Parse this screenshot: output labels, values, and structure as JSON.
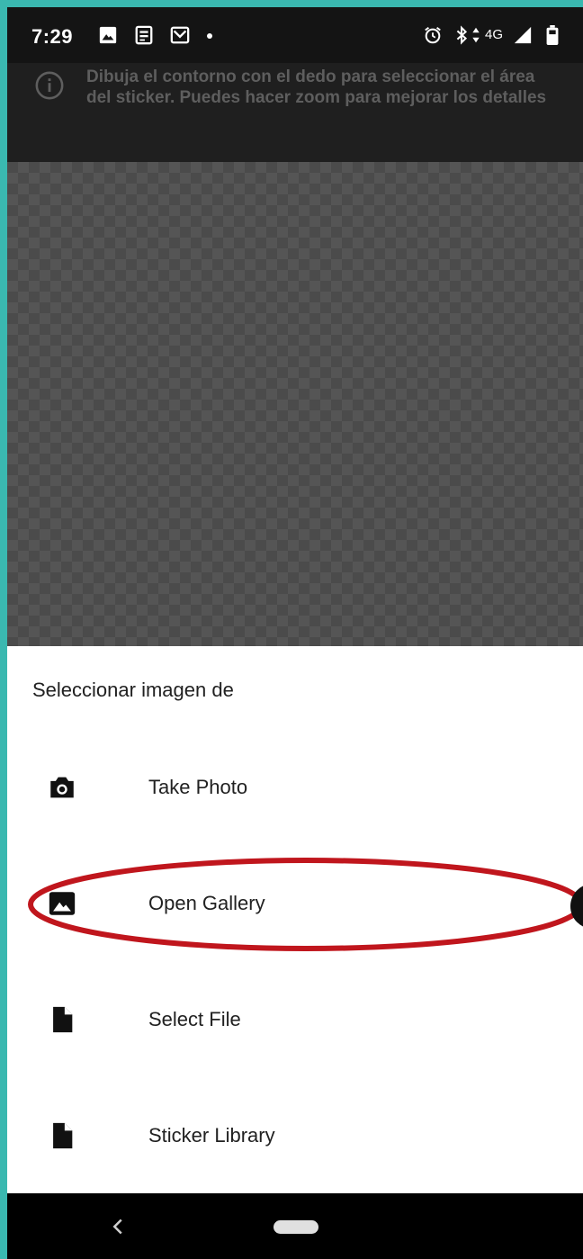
{
  "status_bar": {
    "time": "7:29",
    "network": "4G",
    "icons": [
      "image-notification-icon",
      "news-notification-icon",
      "mail-notification-icon",
      "alarm-icon",
      "bluetooth-icon",
      "data-arrows-icon",
      "signal-icon",
      "battery-icon"
    ]
  },
  "hint": {
    "icon": "info-icon",
    "text": "Dibuja el contorno con el dedo para seleccionar el área del sticker. Puedes hacer zoom para mejorar los detalles"
  },
  "sheet": {
    "title": "Seleccionar imagen de",
    "options": [
      {
        "label": "Take Photo",
        "icon": "camera-icon"
      },
      {
        "label": "Open Gallery",
        "icon": "gallery-icon",
        "highlighted": true
      },
      {
        "label": "Select File",
        "icon": "file-icon"
      },
      {
        "label": "Sticker Library",
        "icon": "file-icon"
      }
    ]
  },
  "colors": {
    "frame": "#3ab8b0",
    "highlight": "#c0161d",
    "sheet_bg": "#ffffff",
    "canvas_light": "#555555",
    "canvas_dark": "#4b4b4b"
  }
}
